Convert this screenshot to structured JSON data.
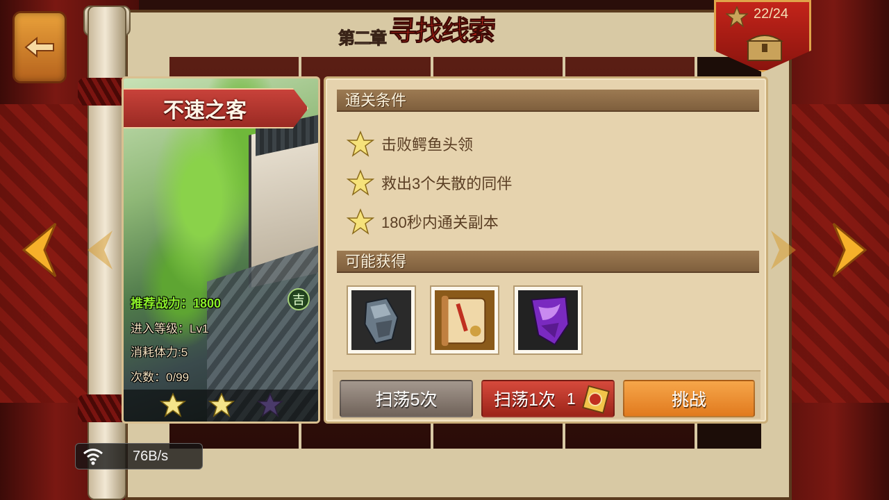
{
  "chapter": {
    "number": "第二章",
    "name": "寻找线索"
  },
  "stars_badge": {
    "count": "22/24"
  },
  "stage": {
    "name": "不速之客",
    "power_label": "推荐战力：1800",
    "level_label": "进入等级：Lv1",
    "stamina_label": "消耗体力:5",
    "count_label": "次数：0/99",
    "luck_badge": "吉",
    "rating": 2,
    "max_rating": 3
  },
  "conditions": {
    "header": "通关条件",
    "items": [
      "击败鳄鱼头领",
      "救出3个失散的同伴",
      "180秒内通关副本"
    ]
  },
  "rewards": {
    "header": "可能获得",
    "items": [
      "gauntlet-icon",
      "scroll-icon",
      "purple-armor-icon"
    ]
  },
  "actions": {
    "sweep5_label": "扫荡5次",
    "sweep1_label": "扫荡1次",
    "sweep1_cost": "1",
    "challenge_label": "挑战"
  },
  "network": {
    "speed": "76B/s"
  },
  "colors": {
    "challenge": "#e8892c",
    "sweep1": "#c43a2e",
    "sweep5": "#8a7c72",
    "panel": "#e6d3ae"
  }
}
